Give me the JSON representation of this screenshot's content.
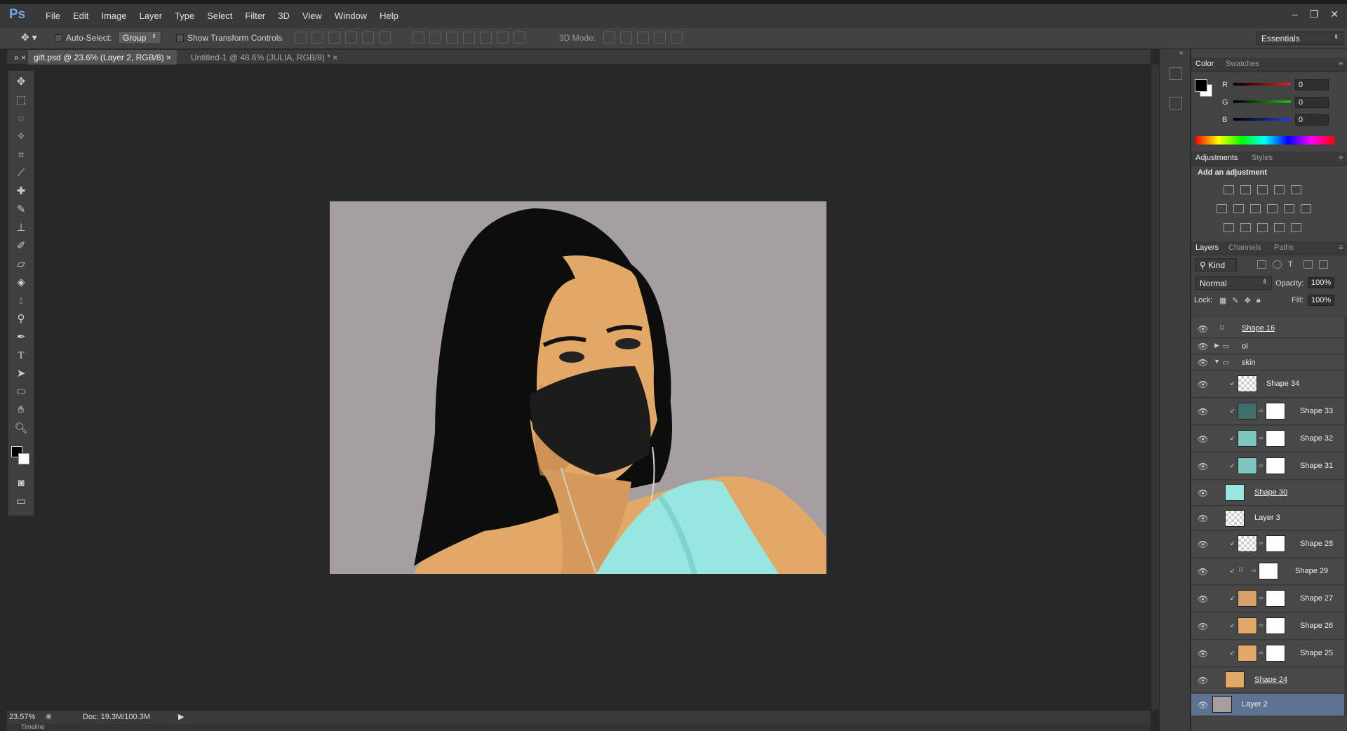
{
  "app": {
    "logo": "Ps"
  },
  "menu": [
    "File",
    "Edit",
    "Image",
    "Layer",
    "Type",
    "Select",
    "Filter",
    "3D",
    "View",
    "Window",
    "Help"
  ],
  "window_controls": {
    "minimize": "–",
    "restore": "❐",
    "close": "✕"
  },
  "options": {
    "auto_select_label": "Auto-Select:",
    "auto_select_value": "Group",
    "transform_label": "Show Transform Controls",
    "mode_3d_label": "3D Mode:",
    "workspace": "Essentials"
  },
  "tabs": [
    {
      "label": "gift.psd @ 23.6% (Layer 2, RGB/8)",
      "close": "×"
    },
    {
      "label": "Untitled-1 @ 48.6% (JULIA, RGB/8) *",
      "close": "×"
    }
  ],
  "status": {
    "zoom": "23.57%",
    "doc": "Doc: 19.3M/100.3M",
    "timeline": "Timeline"
  },
  "color_panel": {
    "tabs": [
      "Color",
      "Swatches"
    ],
    "channels": [
      {
        "label": "R",
        "value": "0",
        "color": "#e02020"
      },
      {
        "label": "G",
        "value": "0",
        "color": "#20c020"
      },
      {
        "label": "B",
        "value": "0",
        "color": "#2040e0"
      }
    ]
  },
  "adjustments_panel": {
    "tabs": [
      "Adjustments",
      "Styles"
    ],
    "heading": "Add an adjustment"
  },
  "layers_panel": {
    "tabs": [
      "Layers",
      "Channels",
      "Paths"
    ],
    "kind": "Kind",
    "blend_mode": "Normal",
    "opacity_label": "Opacity:",
    "opacity": "100%",
    "lock_label": "Lock:",
    "fill_label": "Fill:",
    "fill": "100%",
    "layers": [
      {
        "name": "Shape 16",
        "underline": true
      },
      {
        "name": "ol",
        "group": true
      },
      {
        "name": "skin",
        "group": true,
        "expanded": true
      },
      {
        "name": "Shape 34"
      },
      {
        "name": "Shape 33"
      },
      {
        "name": "Shape 32"
      },
      {
        "name": "Shape 31"
      },
      {
        "name": "Shape 30",
        "underline": true
      },
      {
        "name": "Layer 3"
      },
      {
        "name": "Shape 28"
      },
      {
        "name": "Shape 29"
      },
      {
        "name": "Shape 27"
      },
      {
        "name": "Shape 26"
      },
      {
        "name": "Shape 25"
      },
      {
        "name": "Shape 24",
        "underline": true
      },
      {
        "name": "Layer 2",
        "selected": true
      }
    ]
  },
  "colors": {
    "canvas_bg": "#a59fa2",
    "skin": "#e1a868",
    "hair": "#0d0d0d",
    "mask": "#1c1c1c",
    "dress": "#97e6df",
    "selection": "#5d7391"
  }
}
